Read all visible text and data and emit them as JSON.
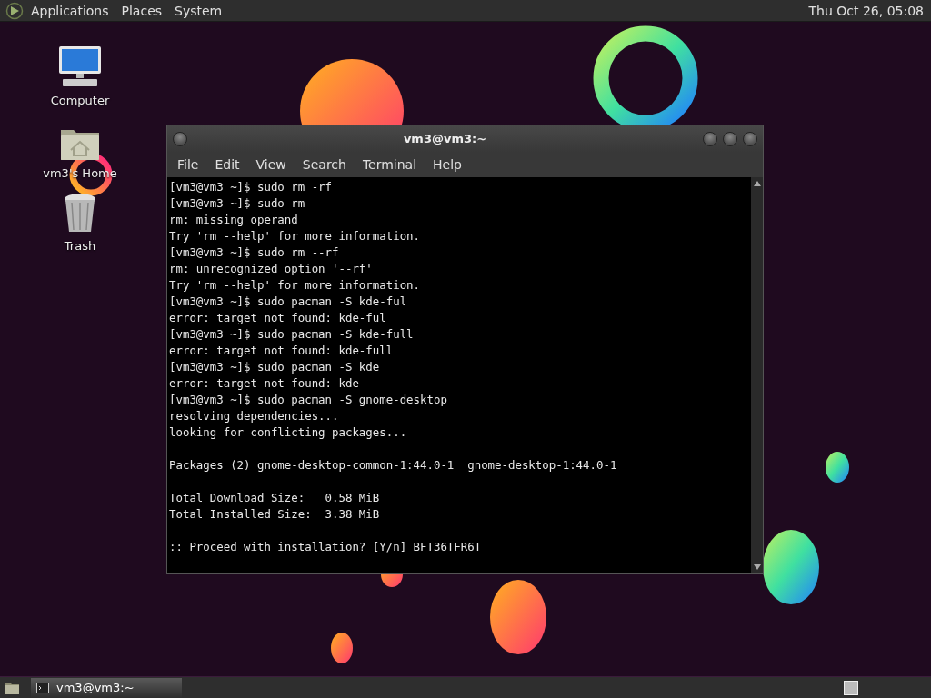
{
  "top_panel": {
    "menus": [
      "Applications",
      "Places",
      "System"
    ],
    "clock": "Thu Oct 26, 05:08"
  },
  "desktop_icons": [
    {
      "label": "Computer",
      "kind": "computer"
    },
    {
      "label": "vm3's Home",
      "kind": "home"
    },
    {
      "label": "Trash",
      "kind": "trash"
    }
  ],
  "window": {
    "title": "vm3@vm3:~",
    "menu": [
      "File",
      "Edit",
      "View",
      "Search",
      "Terminal",
      "Help"
    ],
    "terminal_blocks": [
      [
        "[vm3@vm3 ~]$ sudo rm -rf",
        "[vm3@vm3 ~]$ sudo rm",
        "rm: missing operand",
        "Try 'rm --help' for more information.",
        "[vm3@vm3 ~]$ sudo rm --rf",
        "rm: unrecognized option '--rf'",
        "Try 'rm --help' for more information.",
        "[vm3@vm3 ~]$ sudo pacman -S kde-ful",
        "error: target not found: kde-ful",
        "[vm3@vm3 ~]$ sudo pacman -S kde-full",
        "error: target not found: kde-full",
        "[vm3@vm3 ~]$ sudo pacman -S kde",
        "error: target not found: kde",
        "[vm3@vm3 ~]$ sudo pacman -S gnome-desktop",
        "resolving dependencies...",
        "looking for conflicting packages..."
      ],
      [
        "Packages (2) gnome-desktop-common-1:44.0-1  gnome-desktop-1:44.0-1"
      ],
      [
        "Total Download Size:   0.58 MiB",
        "Total Installed Size:  3.38 MiB"
      ],
      [
        ":: Proceed with installation? [Y/n] BFT36TFR6T"
      ]
    ]
  },
  "taskbar": {
    "tasks": [
      {
        "label": "vm3@vm3:~",
        "selected": true
      }
    ]
  }
}
